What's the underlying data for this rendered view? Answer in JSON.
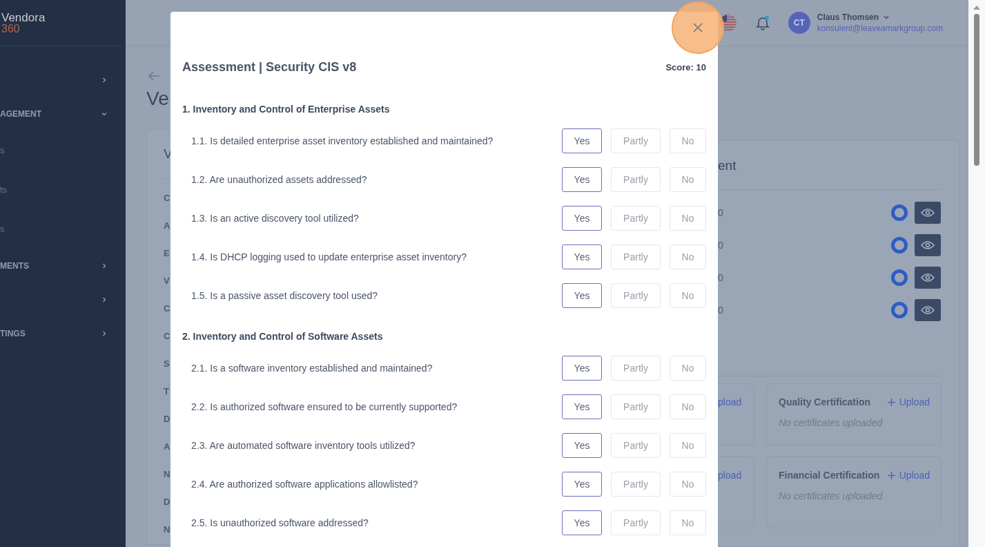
{
  "sidebar": {
    "logo": {
      "name": "Vendora",
      "suffix": "360"
    },
    "items": [
      {
        "kind": "group",
        "expanded": false
      },
      {
        "kind": "group",
        "label": "AGEMENT",
        "expanded": true
      },
      {
        "kind": "sub",
        "label": "s"
      },
      {
        "kind": "sub",
        "label": "ts"
      },
      {
        "kind": "sub",
        "label": "s"
      },
      {
        "kind": "group",
        "label": "MENTS",
        "expanded": false
      },
      {
        "kind": "group",
        "expanded": false
      },
      {
        "kind": "group",
        "label": "TINGS",
        "expanded": false
      }
    ]
  },
  "header": {
    "notifications": {
      "unread": true
    },
    "user": {
      "initials": "CT",
      "name": "Claus Thomsen",
      "email": "konsulent@leaveamarkgroup.com"
    }
  },
  "page": {
    "title": "Ve",
    "left_card": {
      "title": "V",
      "labels": [
        "C",
        "A",
        "E",
        "V",
        "C",
        "C",
        "S",
        "T",
        "D",
        "A",
        "N",
        "D",
        "N"
      ]
    },
    "right_card": {
      "title": "ent",
      "rows": [
        {
          "value": "0"
        },
        {
          "value": "0"
        },
        {
          "value": "0"
        },
        {
          "value": "0"
        }
      ]
    },
    "certificates": [
      {
        "upload": "pload"
      },
      {
        "title": "Quality Certification",
        "upload": "Upload",
        "empty": "No certificates uploaded"
      },
      {
        "upload": "pload"
      },
      {
        "title": "Financial Certification",
        "upload": "Upload",
        "empty": "No certificates uploaded"
      }
    ]
  },
  "modal": {
    "title": "Assessment | Security CIS v8",
    "score": "Score: 10",
    "sections": [
      {
        "title": "1. Inventory and Control of Enterprise Assets",
        "questions": [
          {
            "text": "1.1. Is detailed enterprise asset inventory established and maintained?",
            "options": [
              {
                "label": "Yes",
                "selected": true
              },
              {
                "label": "Partly",
                "selected": false
              },
              {
                "label": "No",
                "selected": false
              }
            ]
          },
          {
            "text": "1.2. Are unauthorized assets addressed?",
            "options": [
              {
                "label": "Yes",
                "selected": true
              },
              {
                "label": "Partly",
                "selected": false
              },
              {
                "label": "No",
                "selected": false
              }
            ]
          },
          {
            "text": "1.3. Is an active discovery tool utilized?",
            "options": [
              {
                "label": "Yes",
                "selected": true
              },
              {
                "label": "Partly",
                "selected": false
              },
              {
                "label": "No",
                "selected": false
              }
            ]
          },
          {
            "text": "1.4. Is DHCP logging used to update enterprise asset inventory?",
            "options": [
              {
                "label": "Yes",
                "selected": true
              },
              {
                "label": "Partly",
                "selected": false
              },
              {
                "label": "No",
                "selected": false
              }
            ]
          },
          {
            "text": "1.5. Is a passive asset discovery tool used?",
            "options": [
              {
                "label": "Yes",
                "selected": true
              },
              {
                "label": "Partly",
                "selected": false
              },
              {
                "label": "No",
                "selected": false
              }
            ]
          }
        ]
      },
      {
        "title": "2. Inventory and Control of Software Assets",
        "questions": [
          {
            "text": "2.1. Is a software inventory established and maintained?",
            "options": [
              {
                "label": "Yes",
                "selected": true
              },
              {
                "label": "Partly",
                "selected": false
              },
              {
                "label": "No",
                "selected": false
              }
            ]
          },
          {
            "text": "2.2. Is authorized software ensured to be currently supported?",
            "options": [
              {
                "label": "Yes",
                "selected": true
              },
              {
                "label": "Partly",
                "selected": false
              },
              {
                "label": "No",
                "selected": false
              }
            ]
          },
          {
            "text": "2.3. Are automated software inventory tools utilized?",
            "options": [
              {
                "label": "Yes",
                "selected": true
              },
              {
                "label": "Partly",
                "selected": false
              },
              {
                "label": "No",
                "selected": false
              }
            ]
          },
          {
            "text": "2.4. Are authorized software applications allowlisted?",
            "options": [
              {
                "label": "Yes",
                "selected": true
              },
              {
                "label": "Partly",
                "selected": false
              },
              {
                "label": "No",
                "selected": false
              }
            ]
          },
          {
            "text": "2.5. Is unauthorized software addressed?",
            "options": [
              {
                "label": "Yes",
                "selected": true
              },
              {
                "label": "Partly",
                "selected": false
              },
              {
                "label": "No",
                "selected": false
              }
            ]
          }
        ]
      }
    ]
  }
}
